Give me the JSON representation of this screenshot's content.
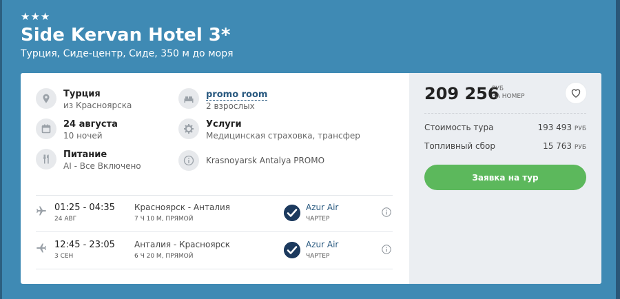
{
  "hotel": {
    "stars": "★★★",
    "name": "Side Kervan Hotel 3*",
    "location": "Турция, Сиде-центр, Сиде, 350 м до моря"
  },
  "info": {
    "country": {
      "title": "Турция",
      "sub": "из Красноярска",
      "icon": "location-pin-icon"
    },
    "dates": {
      "title": "24 августа",
      "sub": "10 ночей",
      "icon": "calendar-icon"
    },
    "meal": {
      "title": "Питание",
      "sub": "AI - Все Включено",
      "icon": "cutlery-icon"
    },
    "room": {
      "title": "promo room",
      "sub": "2 взрослых",
      "icon": "bed-icon"
    },
    "services": {
      "title": "Услуги",
      "sub": "Медицинская страховка, трансфер",
      "icon": "gear-icon"
    },
    "tour": {
      "title": "Krasnoyarsk Antalya PROMO",
      "icon": "info-icon"
    }
  },
  "flights": [
    {
      "time": "01:25 - 04:35",
      "date": "24 АВГ",
      "route": "Красноярск - Анталия",
      "duration": "7 Ч 10 М, ПРЯМОЙ",
      "airline": "Azur Air",
      "type": "ЧАРТЕР"
    },
    {
      "time": "12:45 - 23:05",
      "date": "3 СЕН",
      "route": "Анталия - Красноярск",
      "duration": "6 Ч 20 М, ПРЯМОЙ",
      "airline": "Azur Air",
      "type": "ЧАРТЕР"
    }
  ],
  "price": {
    "total": "209 256",
    "currency": "РУБ",
    "per": "ЗА НОМЕР",
    "tour_cost_label": "Стоимость тура",
    "tour_cost_value": "193 493",
    "fuel_label": "Топливный сбор",
    "fuel_value": "15 763",
    "unit": "РУБ",
    "book_label": "Заявка на тур"
  },
  "colors": {
    "background": "#3f8ab4",
    "button": "#5cb85c",
    "link": "#2a5a80"
  }
}
